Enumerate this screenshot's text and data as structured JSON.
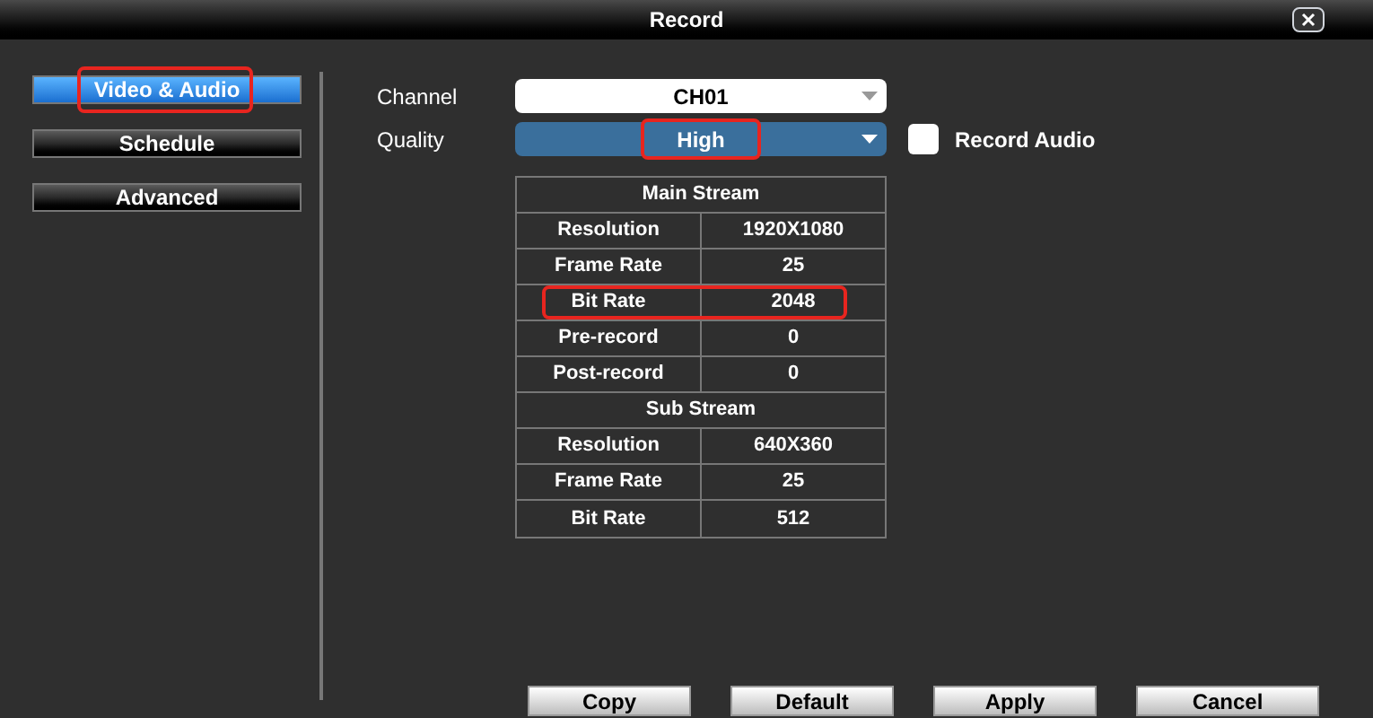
{
  "window": {
    "title": "Record"
  },
  "sidebar": {
    "items": [
      {
        "label": "Video & Audio",
        "selected": true,
        "highlighted": true
      },
      {
        "label": "Schedule",
        "selected": false,
        "highlighted": false
      },
      {
        "label": "Advanced",
        "selected": false,
        "highlighted": false
      }
    ]
  },
  "channel": {
    "label": "Channel",
    "value": "CH01",
    "highlighted": false
  },
  "quality": {
    "label": "Quality",
    "value": "High",
    "highlighted": true
  },
  "record_audio": {
    "label": "Record Audio",
    "checked": false
  },
  "table": {
    "sections": [
      {
        "title": "Main Stream",
        "rows": [
          {
            "name": "Resolution",
            "value": "1920X1080",
            "highlighted": false
          },
          {
            "name": "Frame Rate",
            "value": "25",
            "highlighted": false
          },
          {
            "name": "Bit Rate",
            "value": "2048",
            "highlighted": true
          },
          {
            "name": "Pre-record",
            "value": "0",
            "highlighted": false
          },
          {
            "name": "Post-record",
            "value": "0",
            "highlighted": false
          }
        ]
      },
      {
        "title": "Sub Stream",
        "rows": [
          {
            "name": "Resolution",
            "value": "640X360",
            "highlighted": false
          },
          {
            "name": "Frame Rate",
            "value": "25",
            "highlighted": false
          },
          {
            "name": "Bit Rate",
            "value": "512",
            "highlighted": false
          }
        ]
      }
    ]
  },
  "buttons": [
    "Copy",
    "Default",
    "Apply",
    "Cancel"
  ]
}
